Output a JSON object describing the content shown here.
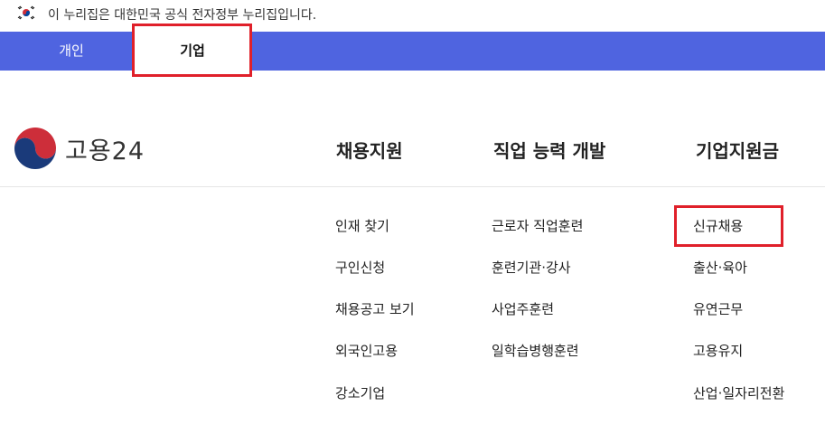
{
  "gov_banner": {
    "text": "이 누리집은 대한민국 공식 전자정부 누리집입니다."
  },
  "tabs": [
    {
      "label": "개인"
    },
    {
      "label": "기업"
    }
  ],
  "logo": {
    "text": "고용24"
  },
  "menu": [
    {
      "title": "채용지원",
      "items": [
        "인재 찾기",
        "구인신청",
        "채용공고 보기",
        "외국인고용",
        "강소기업"
      ]
    },
    {
      "title": "직업 능력 개발",
      "items": [
        "근로자 직업훈련",
        "훈련기관·강사",
        "사업주훈련",
        "일학습병행훈련"
      ]
    },
    {
      "title": "기업지원금",
      "items": [
        "신규채용",
        "출산·육아",
        "유연근무",
        "고용유지",
        "산업·일자리전환"
      ]
    }
  ],
  "colors": {
    "tabbar": "#4f64e0",
    "highlight": "#e0202a"
  }
}
